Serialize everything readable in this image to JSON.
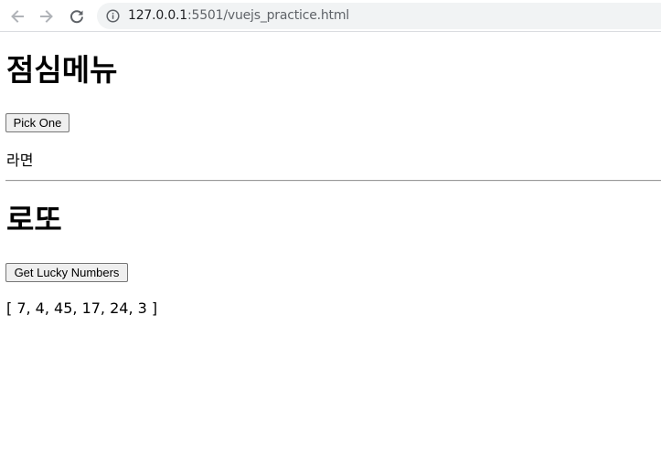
{
  "browser": {
    "url_host": "127.0.0.1",
    "url_path": ":5501/vuejs_practice.html",
    "icons": {
      "back": "arrow-left-icon",
      "forward": "arrow-right-icon",
      "reload": "reload-icon",
      "info": "info-icon"
    }
  },
  "lunch": {
    "heading": "점심메뉴",
    "button_label": "Pick One",
    "result": "라면"
  },
  "lotto": {
    "heading": "로또",
    "button_label": "Get Lucky Numbers",
    "result": "[ 7, 4, 45, 17, 24, 3 ]"
  }
}
